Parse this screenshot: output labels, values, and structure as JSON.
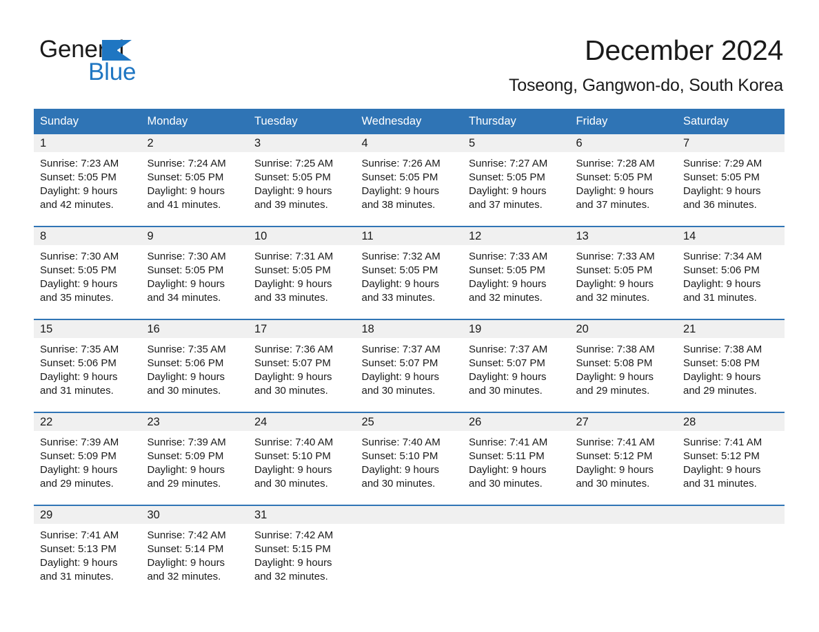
{
  "brand": {
    "name_part1": "General",
    "name_part2": "Blue",
    "triangle_icon": "triangle-icon",
    "accent_color": "#1f76c2"
  },
  "header": {
    "title": "December 2024",
    "subtitle": "Toseong, Gangwon-do, South Korea"
  },
  "theme": {
    "header_blue": "#2f74b5",
    "daynum_strip": "#f0f0f0",
    "text": "#1a1a1a"
  },
  "calendar": {
    "weekday_headers": [
      "Sunday",
      "Monday",
      "Tuesday",
      "Wednesday",
      "Thursday",
      "Friday",
      "Saturday"
    ],
    "weeks": [
      [
        {
          "day": "1",
          "sunrise": "Sunrise: 7:23 AM",
          "sunset": "Sunset: 5:05 PM",
          "daylight_line1": "Daylight: 9 hours",
          "daylight_line2": "and 42 minutes."
        },
        {
          "day": "2",
          "sunrise": "Sunrise: 7:24 AM",
          "sunset": "Sunset: 5:05 PM",
          "daylight_line1": "Daylight: 9 hours",
          "daylight_line2": "and 41 minutes."
        },
        {
          "day": "3",
          "sunrise": "Sunrise: 7:25 AM",
          "sunset": "Sunset: 5:05 PM",
          "daylight_line1": "Daylight: 9 hours",
          "daylight_line2": "and 39 minutes."
        },
        {
          "day": "4",
          "sunrise": "Sunrise: 7:26 AM",
          "sunset": "Sunset: 5:05 PM",
          "daylight_line1": "Daylight: 9 hours",
          "daylight_line2": "and 38 minutes."
        },
        {
          "day": "5",
          "sunrise": "Sunrise: 7:27 AM",
          "sunset": "Sunset: 5:05 PM",
          "daylight_line1": "Daylight: 9 hours",
          "daylight_line2": "and 37 minutes."
        },
        {
          "day": "6",
          "sunrise": "Sunrise: 7:28 AM",
          "sunset": "Sunset: 5:05 PM",
          "daylight_line1": "Daylight: 9 hours",
          "daylight_line2": "and 37 minutes."
        },
        {
          "day": "7",
          "sunrise": "Sunrise: 7:29 AM",
          "sunset": "Sunset: 5:05 PM",
          "daylight_line1": "Daylight: 9 hours",
          "daylight_line2": "and 36 minutes."
        }
      ],
      [
        {
          "day": "8",
          "sunrise": "Sunrise: 7:30 AM",
          "sunset": "Sunset: 5:05 PM",
          "daylight_line1": "Daylight: 9 hours",
          "daylight_line2": "and 35 minutes."
        },
        {
          "day": "9",
          "sunrise": "Sunrise: 7:30 AM",
          "sunset": "Sunset: 5:05 PM",
          "daylight_line1": "Daylight: 9 hours",
          "daylight_line2": "and 34 minutes."
        },
        {
          "day": "10",
          "sunrise": "Sunrise: 7:31 AM",
          "sunset": "Sunset: 5:05 PM",
          "daylight_line1": "Daylight: 9 hours",
          "daylight_line2": "and 33 minutes."
        },
        {
          "day": "11",
          "sunrise": "Sunrise: 7:32 AM",
          "sunset": "Sunset: 5:05 PM",
          "daylight_line1": "Daylight: 9 hours",
          "daylight_line2": "and 33 minutes."
        },
        {
          "day": "12",
          "sunrise": "Sunrise: 7:33 AM",
          "sunset": "Sunset: 5:05 PM",
          "daylight_line1": "Daylight: 9 hours",
          "daylight_line2": "and 32 minutes."
        },
        {
          "day": "13",
          "sunrise": "Sunrise: 7:33 AM",
          "sunset": "Sunset: 5:05 PM",
          "daylight_line1": "Daylight: 9 hours",
          "daylight_line2": "and 32 minutes."
        },
        {
          "day": "14",
          "sunrise": "Sunrise: 7:34 AM",
          "sunset": "Sunset: 5:06 PM",
          "daylight_line1": "Daylight: 9 hours",
          "daylight_line2": "and 31 minutes."
        }
      ],
      [
        {
          "day": "15",
          "sunrise": "Sunrise: 7:35 AM",
          "sunset": "Sunset: 5:06 PM",
          "daylight_line1": "Daylight: 9 hours",
          "daylight_line2": "and 31 minutes."
        },
        {
          "day": "16",
          "sunrise": "Sunrise: 7:35 AM",
          "sunset": "Sunset: 5:06 PM",
          "daylight_line1": "Daylight: 9 hours",
          "daylight_line2": "and 30 minutes."
        },
        {
          "day": "17",
          "sunrise": "Sunrise: 7:36 AM",
          "sunset": "Sunset: 5:07 PM",
          "daylight_line1": "Daylight: 9 hours",
          "daylight_line2": "and 30 minutes."
        },
        {
          "day": "18",
          "sunrise": "Sunrise: 7:37 AM",
          "sunset": "Sunset: 5:07 PM",
          "daylight_line1": "Daylight: 9 hours",
          "daylight_line2": "and 30 minutes."
        },
        {
          "day": "19",
          "sunrise": "Sunrise: 7:37 AM",
          "sunset": "Sunset: 5:07 PM",
          "daylight_line1": "Daylight: 9 hours",
          "daylight_line2": "and 30 minutes."
        },
        {
          "day": "20",
          "sunrise": "Sunrise: 7:38 AM",
          "sunset": "Sunset: 5:08 PM",
          "daylight_line1": "Daylight: 9 hours",
          "daylight_line2": "and 29 minutes."
        },
        {
          "day": "21",
          "sunrise": "Sunrise: 7:38 AM",
          "sunset": "Sunset: 5:08 PM",
          "daylight_line1": "Daylight: 9 hours",
          "daylight_line2": "and 29 minutes."
        }
      ],
      [
        {
          "day": "22",
          "sunrise": "Sunrise: 7:39 AM",
          "sunset": "Sunset: 5:09 PM",
          "daylight_line1": "Daylight: 9 hours",
          "daylight_line2": "and 29 minutes."
        },
        {
          "day": "23",
          "sunrise": "Sunrise: 7:39 AM",
          "sunset": "Sunset: 5:09 PM",
          "daylight_line1": "Daylight: 9 hours",
          "daylight_line2": "and 29 minutes."
        },
        {
          "day": "24",
          "sunrise": "Sunrise: 7:40 AM",
          "sunset": "Sunset: 5:10 PM",
          "daylight_line1": "Daylight: 9 hours",
          "daylight_line2": "and 30 minutes."
        },
        {
          "day": "25",
          "sunrise": "Sunrise: 7:40 AM",
          "sunset": "Sunset: 5:10 PM",
          "daylight_line1": "Daylight: 9 hours",
          "daylight_line2": "and 30 minutes."
        },
        {
          "day": "26",
          "sunrise": "Sunrise: 7:41 AM",
          "sunset": "Sunset: 5:11 PM",
          "daylight_line1": "Daylight: 9 hours",
          "daylight_line2": "and 30 minutes."
        },
        {
          "day": "27",
          "sunrise": "Sunrise: 7:41 AM",
          "sunset": "Sunset: 5:12 PM",
          "daylight_line1": "Daylight: 9 hours",
          "daylight_line2": "and 30 minutes."
        },
        {
          "day": "28",
          "sunrise": "Sunrise: 7:41 AM",
          "sunset": "Sunset: 5:12 PM",
          "daylight_line1": "Daylight: 9 hours",
          "daylight_line2": "and 31 minutes."
        }
      ],
      [
        {
          "day": "29",
          "sunrise": "Sunrise: 7:41 AM",
          "sunset": "Sunset: 5:13 PM",
          "daylight_line1": "Daylight: 9 hours",
          "daylight_line2": "and 31 minutes."
        },
        {
          "day": "30",
          "sunrise": "Sunrise: 7:42 AM",
          "sunset": "Sunset: 5:14 PM",
          "daylight_line1": "Daylight: 9 hours",
          "daylight_line2": "and 32 minutes."
        },
        {
          "day": "31",
          "sunrise": "Sunrise: 7:42 AM",
          "sunset": "Sunset: 5:15 PM",
          "daylight_line1": "Daylight: 9 hours",
          "daylight_line2": "and 32 minutes."
        },
        {
          "day": "",
          "sunrise": "",
          "sunset": "",
          "daylight_line1": "",
          "daylight_line2": ""
        },
        {
          "day": "",
          "sunrise": "",
          "sunset": "",
          "daylight_line1": "",
          "daylight_line2": ""
        },
        {
          "day": "",
          "sunrise": "",
          "sunset": "",
          "daylight_line1": "",
          "daylight_line2": ""
        },
        {
          "day": "",
          "sunrise": "",
          "sunset": "",
          "daylight_line1": "",
          "daylight_line2": ""
        }
      ]
    ]
  }
}
